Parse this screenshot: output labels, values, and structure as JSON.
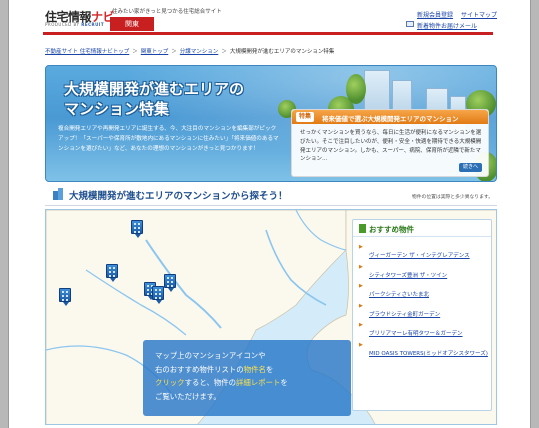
{
  "header": {
    "logo_main": "住宅情報",
    "logo_navi": "ナビ",
    "logo_sub_produced": "PRODUCED BY",
    "logo_sub_brand": "RECRUIT",
    "tagline": "住みたい家がきっと見つかる住宅総合サイト",
    "region_tab": "関東",
    "links": {
      "register": "新規会員登録",
      "sitemap": "サイトマップ",
      "mail": "新着物件お届けメール"
    }
  },
  "breadcrumb": {
    "items": [
      "不動産サイト 住宅情報ナビトップ",
      "関東トップ",
      "分譲マンション",
      "大規模開発が進むエリアのマンション特集"
    ],
    "separator": "＞"
  },
  "hero": {
    "title_line1": "大規模開発が進むエリアの",
    "title_line2": "マンション特集",
    "description": "複合開発エリアや再開発エリアに誕生する、今、大注目のマンションを編集部がピックアップ！「スーパーや保育所が敷地内にあるマンションに住みたい」「将来価値のあるマンションを選びたい」など、あなたの理想のマンションがきっと見つかります！",
    "feature": {
      "tag": "特集",
      "title": "将来価値で選ぶ大規模開発エリアのマンション",
      "text": "せっかくマンションを買うなら、毎日に生活が便利になるマンションを選びたい。そこで注目したいのが、便利・安全・快適を期待できる大規模開発エリアのマンション。しかも、スーパー、病院、保育所が近隣で新たマンション…",
      "more": "続きへ"
    }
  },
  "section": {
    "title": "大規模開発が進むエリアのマンションから探そう！",
    "note": "物件の位置は実際と多少異なります。"
  },
  "map": {
    "instructions": [
      "マップ上のマンションアイコンや",
      "右のおすすめ物件リストの物件名を",
      "クリックすると、物件の詳細レポートを",
      "ご覧いただけます。"
    ],
    "highlight_words": [
      "物件名",
      "詳細レポート"
    ],
    "marker_count": 6
  },
  "recommended": {
    "title": "おすすめ物件",
    "items": [
      "ヴィーガーデン ザ・インテグレアデンス",
      "シティタワーズ豊洲 ザ・ツイン",
      "パークシティさいたま北",
      "プラウドシティ金町ガーデン",
      "ブリリアマーレ有明タワー＆ガーデン",
      "MID OASIS TOWERS(ミッドオアシスタワーズ)"
    ]
  },
  "colors": {
    "brand_red": "#c82020",
    "link_blue": "#1a45a8",
    "hero_blue": "#4a99d4",
    "feature_orange": "#e27a14",
    "rec_green": "#2a7a1a"
  }
}
